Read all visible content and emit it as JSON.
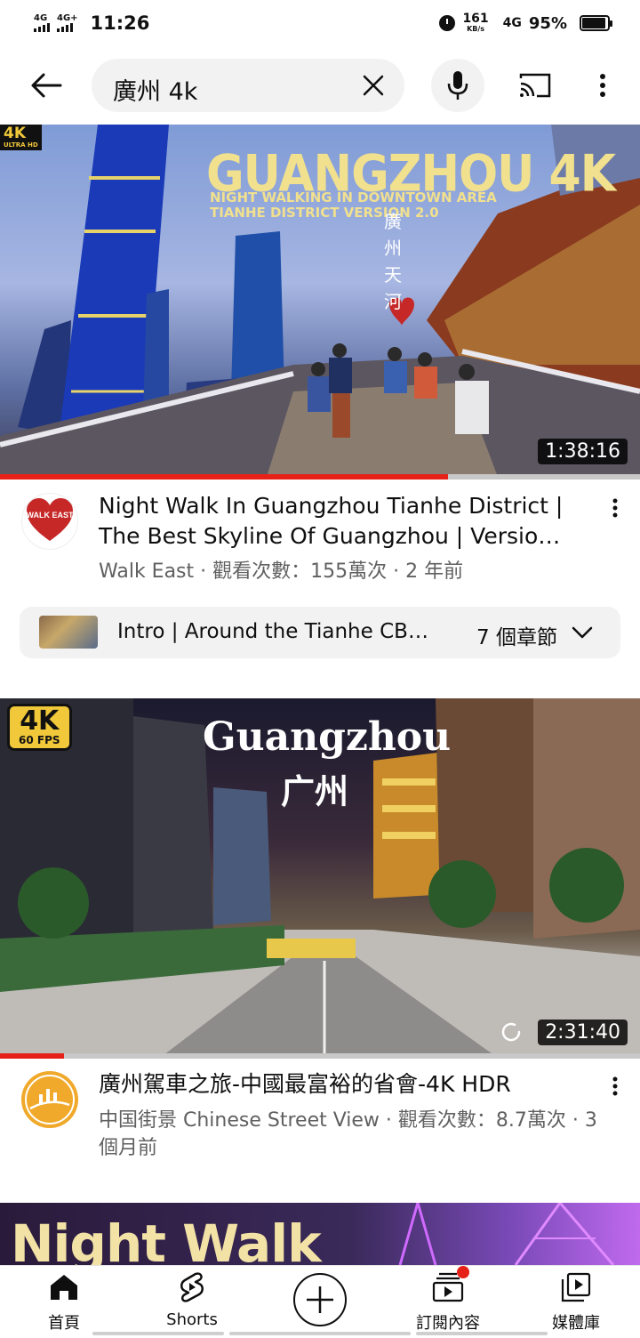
{
  "status_bar": {
    "signal1": "4G",
    "signal2": "4G+",
    "time": "11:26",
    "speed_value": "161",
    "speed_unit": "KB/s",
    "network": "4G",
    "battery": "95%"
  },
  "search": {
    "query": "廣州 4k"
  },
  "icons": {
    "back": "arrow-left-icon",
    "clear": "close-icon",
    "mic": "microphone-icon",
    "cast": "cast-icon",
    "more": "more-vert-icon"
  },
  "videos": [
    {
      "thumbnail_badge": "4K",
      "thumbnail_badge_sub": "ULTRA HD",
      "thumbnail_title": "GUANGZHOU 4K",
      "thumbnail_subtitle_1": "NIGHT WALKING IN DOWNTOWN AREA",
      "thumbnail_subtitle_2": "TIANHE DISTRICT VERSION 2.0",
      "thumbnail_vertical_text": "廣州天河",
      "duration": "1:38:16",
      "watched_fraction": 0.7,
      "channel_avatar_text": "WALK EAST",
      "title": "Night Walk In Guangzhou Tianhe District | The Best Skyline Of Guangzhou | Versio…",
      "meta": "Walk East · 觀看次數：155萬次 · 2 年前",
      "chapters": {
        "label": "Intro | Around the Tianhe CBD…",
        "count": "7 個章節"
      }
    },
    {
      "thumbnail_badge": "4K",
      "thumbnail_badge_sub": "60 FPS",
      "thumbnail_title": "Guangzhou",
      "thumbnail_subtitle": "广州",
      "duration": "2:31:40",
      "watched_fraction": 0.1,
      "title": "廣州駕車之旅-中國最富裕的省會-4K HDR",
      "meta": "中国街景 Chinese Street View · 觀看次數：8.7萬次 · 3 個月前"
    },
    {
      "thumbnail_title": "Night Walk"
    }
  ],
  "bottom_nav": [
    {
      "label": "首頁",
      "icon": "home-icon"
    },
    {
      "label": "Shorts",
      "icon": "shorts-icon"
    },
    {
      "label": "",
      "icon": "create-plus-icon"
    },
    {
      "label": "訂閱內容",
      "icon": "subscriptions-icon"
    },
    {
      "label": "媒體庫",
      "icon": "library-icon"
    }
  ],
  "colors": {
    "accent_red": "#e62117",
    "text_primary": "#0f0f0f",
    "text_secondary": "#606060",
    "chip_bg": "#f2f2f2"
  }
}
